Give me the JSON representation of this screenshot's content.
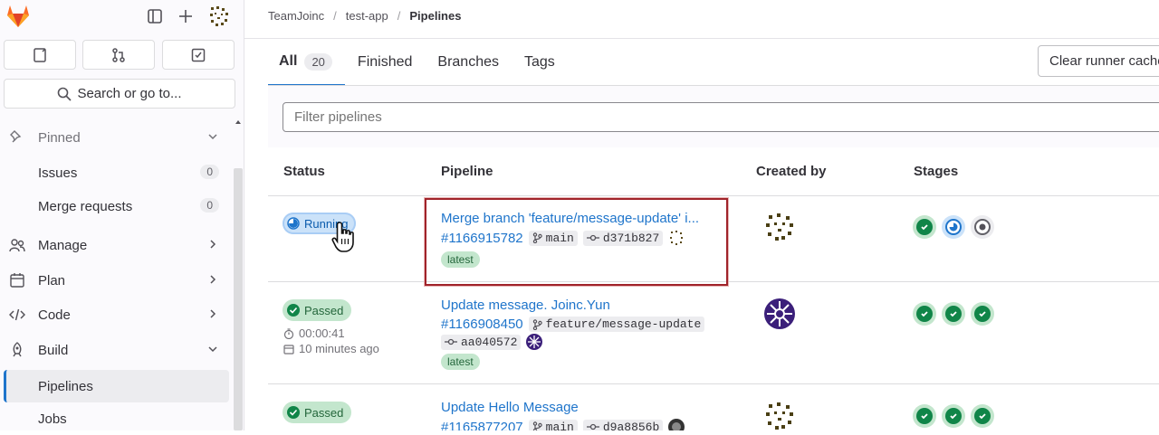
{
  "sidebar": {
    "search_label": "Search or go to...",
    "items": [
      {
        "label": "Pinned",
        "icon": "pin-icon",
        "type": "section"
      },
      {
        "label": "Issues",
        "count": "0"
      },
      {
        "label": "Merge requests",
        "count": "0"
      },
      {
        "label": "Manage",
        "icon": "users-icon"
      },
      {
        "label": "Plan",
        "icon": "calendar-icon"
      },
      {
        "label": "Code",
        "icon": "code-icon"
      },
      {
        "label": "Build",
        "icon": "rocket-icon"
      },
      {
        "label": "Pipelines",
        "active": true
      },
      {
        "label": "Jobs"
      }
    ]
  },
  "breadcrumb": {
    "org": "TeamJoinc",
    "project": "test-app",
    "current": "Pipelines"
  },
  "tabs": [
    {
      "label": "All",
      "count": "20",
      "active": true
    },
    {
      "label": "Finished"
    },
    {
      "label": "Branches"
    },
    {
      "label": "Tags"
    }
  ],
  "clear_cache_label": "Clear runner caches",
  "filter_placeholder": "Filter pipelines",
  "table": {
    "headers": {
      "status": "Status",
      "pipeline": "Pipeline",
      "created_by": "Created by",
      "stages": "Stages"
    },
    "rows": [
      {
        "status": "Running",
        "title": "Merge branch 'feature/message-update' i...",
        "id": "#1166915782",
        "branch": "main",
        "commit": "d371b827",
        "tag": "latest",
        "stages": [
          "success",
          "running",
          "pending"
        ]
      },
      {
        "status": "Passed",
        "duration": "00:00:41",
        "finished": "10 minutes ago",
        "title": "Update message. Joinc.Yun",
        "id": "#1166908450",
        "branch": "feature/message-update",
        "commit": "aa040572",
        "tag": "latest",
        "stages": [
          "success",
          "success",
          "success"
        ]
      },
      {
        "status": "Passed",
        "title": "Update Hello Message",
        "id": "#1165877207",
        "branch": "main",
        "commit": "d9a8856b",
        "stages": [
          "success",
          "success",
          "success"
        ]
      }
    ]
  },
  "colors": {
    "accent": "#1f75cb",
    "success": "#108548",
    "highlight": "#a0232a"
  }
}
